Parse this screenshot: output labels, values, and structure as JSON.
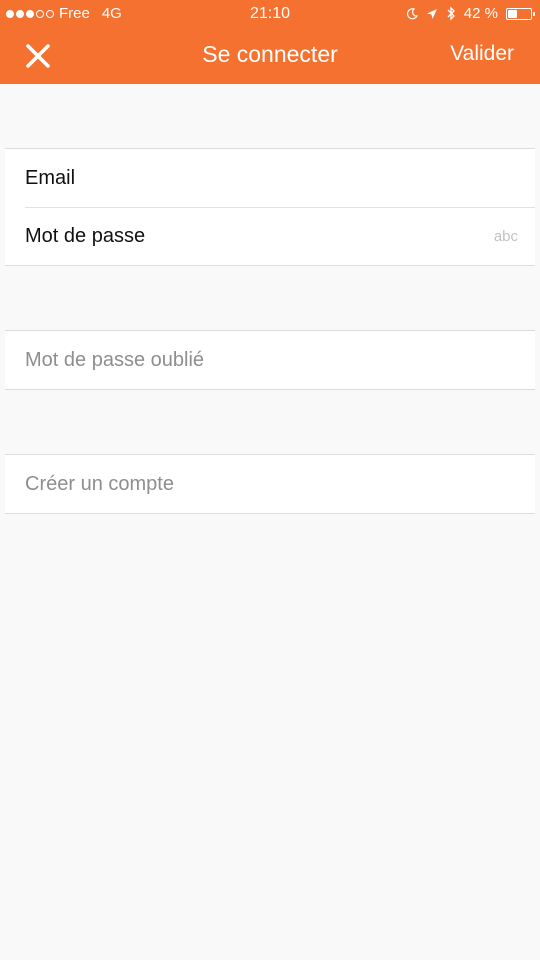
{
  "status_bar": {
    "carrier": "Free",
    "network": "4G",
    "time": "21:10",
    "battery_text": "42 %",
    "battery_level": 0.42,
    "icons": [
      "moon-icon",
      "location-arrow-icon",
      "bluetooth-icon"
    ]
  },
  "nav": {
    "close_icon": "close-icon",
    "title": "Se connecter",
    "validate_label": "Valider"
  },
  "form": {
    "email_label": "Email",
    "email_value": "",
    "password_label": "Mot de passe",
    "password_hint": "abc",
    "password_value": ""
  },
  "links": {
    "forgot_password": "Mot de passe oublié",
    "create_account": "Créer un compte"
  },
  "colors": {
    "accent": "#f4712f",
    "background": "#f9f9f9",
    "link_text": "#8e8e8e"
  }
}
